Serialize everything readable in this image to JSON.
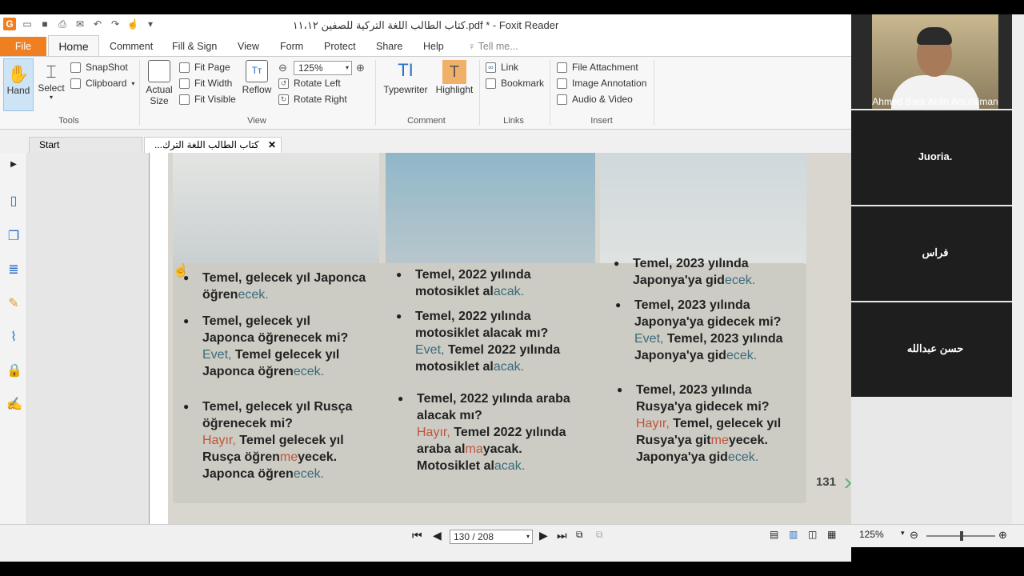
{
  "window": {
    "title": "كتاب الطالب اللغة التركية للصفين ١١،١٢.pdf * - Foxit Reader"
  },
  "menu": {
    "file": "File",
    "tabs": [
      "Home",
      "Comment",
      "Fill & Sign",
      "View",
      "Form",
      "Protect",
      "Share",
      "Help"
    ],
    "tell_me": "Tell me..."
  },
  "ribbon": {
    "tools": {
      "hand": "Hand",
      "select": "Select",
      "snapshot": "SnapShot",
      "clipboard": "Clipboard",
      "group": "Tools"
    },
    "view": {
      "actual_size_1": "Actual",
      "actual_size_2": "Size",
      "fit_page": "Fit Page",
      "fit_width": "Fit Width",
      "fit_visible": "Fit Visible",
      "reflow": "Reflow",
      "zoom": "125%",
      "rotate_left": "Rotate Left",
      "rotate_right": "Rotate Right",
      "group": "View"
    },
    "comment": {
      "typewriter": "Typewriter",
      "highlight": "Highlight",
      "group": "Comment"
    },
    "links": {
      "link": "Link",
      "bookmark": "Bookmark",
      "group": "Links"
    },
    "insert": {
      "file_attachment": "File Attachment",
      "image_annotation": "Image Annotation",
      "audio_video": "Audio & Video",
      "group": "Insert"
    }
  },
  "doc_tabs": {
    "start": "Start",
    "current": "...كتاب الطالب اللغة الترك"
  },
  "page_content": {
    "col1": {
      "r1a": "Temel, gelecek yıl Japonca",
      "r1b_pre": "öğren",
      "r1b_suf": "ecek.",
      "r2a": "Temel, gelecek yıl",
      "r2b": "Japonca öğrenecek mi?",
      "r2c_yes": "Evet,",
      "r2c": " Temel gelecek yıl",
      "r2d_pre": "Japonca öğren",
      "r2d_suf": "ecek.",
      "r3a": "Temel, gelecek yıl Rusça",
      "r3b": "öğrenecek mi?",
      "r3c_no": "Hayır,",
      "r3c": " Temel gelecek yıl",
      "r3d_pre": "Rusça öğren",
      "r3d_neg": "me",
      "r3d_suf": "yecek.",
      "r3e_pre": "Japonca öğren",
      "r3e_suf": "ecek."
    },
    "col2": {
      "r1a": "Temel, 2022 yılında",
      "r1b_pre": "motosiklet al",
      "r1b_suf": "acak.",
      "r2a": "Temel, 2022 yılında",
      "r2b": "motosiklet alacak mı?",
      "r2c_yes": "Evet,",
      "r2c": " Temel 2022 yılında",
      "r2d_pre": "motosiklet al",
      "r2d_suf": "acak.",
      "r3a": "Temel, 2022 yılında araba",
      "r3b": "alacak mı?",
      "r3c_no": "Hayır,",
      "r3c": " Temel 2022 yılında",
      "r3d_pre": "araba al",
      "r3d_neg": "ma",
      "r3d_suf": "yacak.",
      "r3e_pre": "Motosiklet al",
      "r3e_suf": "acak."
    },
    "col3": {
      "r1a": "Temel, 2023 yılında",
      "r1b_pre": "Japonya'ya gid",
      "r1b_suf": "ecek.",
      "r2a": "Temel, 2023 yılında",
      "r2b": "Japonya'ya gidecek mi?",
      "r2c_yes": "Evet,",
      "r2c": " Temel, 2023 yılında",
      "r2d_pre": "Japonya'ya gid",
      "r2d_suf": "ecek.",
      "r3a": "Temel, 2023 yılında",
      "r3b": "Rusya'ya gidecek mi?",
      "r3c_no": "Hayır,",
      "r3c": " Temel, gelecek yıl",
      "r3d_pre": "Rusya'ya git",
      "r3d_neg": "me",
      "r3d_suf": "yecek.",
      "r3e_pre": "Japonya'ya gid",
      "r3e_suf": "ecek."
    },
    "page_number": "131"
  },
  "status": {
    "page": "130 / 208",
    "zoom": "125%"
  },
  "participants": [
    {
      "name": "Ahmed Badr Aldin Alsulaiman"
    },
    {
      "name": "Juoria."
    },
    {
      "name": "فراس"
    },
    {
      "name": "حسن عبدالله"
    }
  ],
  "colors": {
    "accent": "#f07f22",
    "link_blue": "#2a6fc9",
    "suffix": "#3a6a7a",
    "negation": "#c0543b"
  }
}
